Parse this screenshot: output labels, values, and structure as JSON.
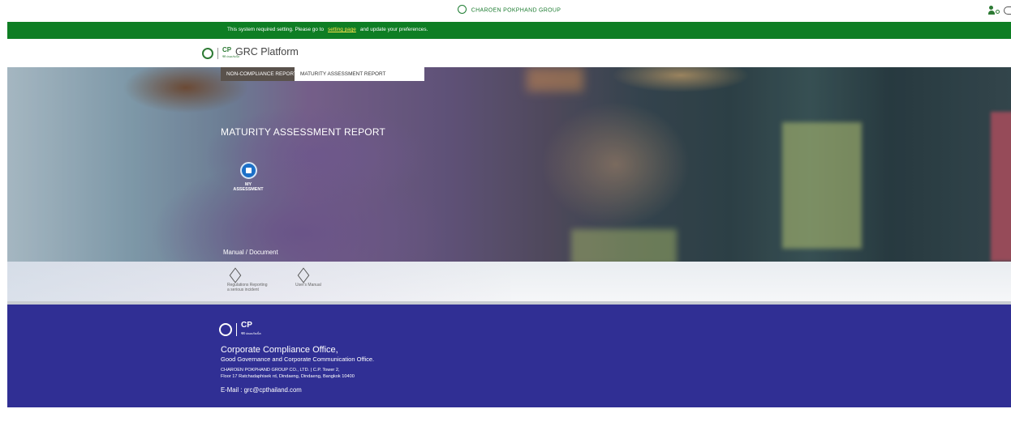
{
  "topbar": {
    "brand": "CHAROEN POKPHAND GROUP",
    "icons": [
      "user-settings-icon",
      "logout-icon"
    ]
  },
  "notice": {
    "before": "This system required setting. Please go to",
    "link": "setting page",
    "after": "and update your preferences."
  },
  "header": {
    "app_title": "GRC Platform",
    "logo_text": "CP",
    "logo_sub": "ซีพี ปลอดภัยเน็ต"
  },
  "tabs": [
    {
      "label": "NON-COMPLIANCE REPORT"
    },
    {
      "label": "MATURITY ASSESSMENT REPORT"
    }
  ],
  "hero": {
    "title": "MATURITY ASSESSMENT REPORT",
    "assessment_line1": "MY",
    "assessment_line2": "ASSESSMENT"
  },
  "manual": {
    "title": "Manual / Document",
    "docs": [
      {
        "line1": "Regulations Reporting",
        "line2": "a serious incident"
      },
      {
        "line1": "User's Manual",
        "line2": ""
      }
    ]
  },
  "footer": {
    "logo_text": "CP",
    "logo_sub": "ซีพี ปลอดภัยเน็ต",
    "title": "Corporate Compliance Office,",
    "subtitle": "Good Governance and Corporate Communication Office.",
    "address1": "CHAROEN POKPHAND GROUP CO., LTD. | C.P. Tower 2,",
    "address2": "Floor 17 Ratchadaphisek rd, Dindaeng, Dindaeng, Bangkok 10400",
    "email": "E-Mail : grc@cpthailand.com"
  },
  "colors": {
    "brand_green": "#0e7e24",
    "footer_blue": "#302f94",
    "link_yellow": "#ffe34a",
    "assessment_blue": "#1c70c7"
  }
}
